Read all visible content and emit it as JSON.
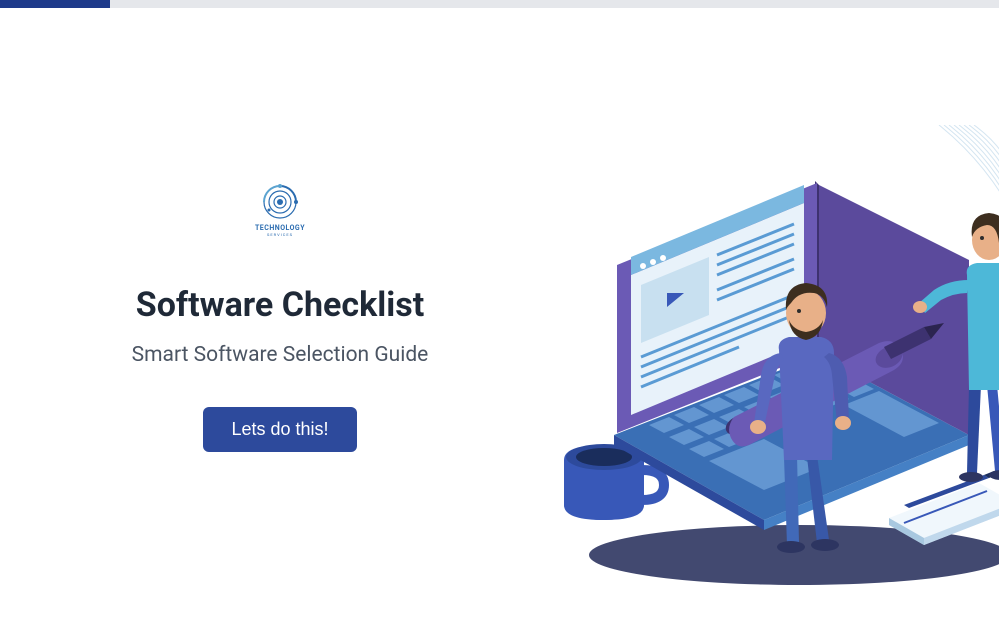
{
  "logo": {
    "title": "TECHNOLOGY",
    "subtitle": "SERVICES"
  },
  "hero": {
    "heading": "Software Checklist",
    "subtitle": "Smart Software Selection Guide",
    "cta_label": "Lets do this!"
  },
  "progress": {
    "percent": 11
  }
}
